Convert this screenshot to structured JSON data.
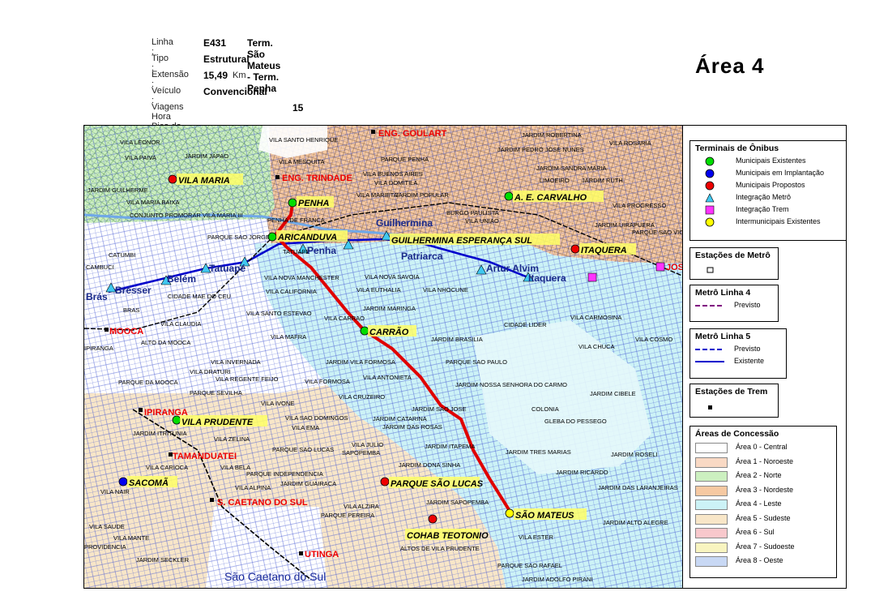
{
  "info": {
    "linha_label": "Linha :",
    "linha_value": "E431",
    "linha_name": "Term. São Mateus - Term. Penha",
    "tipo_label": "Tipo :",
    "tipo_value": "Estrutural",
    "extensao_label": "Extensão :",
    "extensao_value": "15,49",
    "extensao_unit": "Km",
    "veiculo_label": "Veículo :",
    "veiculo_value": "Convencional",
    "viagens_label": "Viagens Hora Pico da Manhã",
    "viagens_value": "15"
  },
  "area_title": "Área  4",
  "colors": {
    "route": "#e00000",
    "metro_line5": "#0000cc",
    "metro_line4": "#800080",
    "area_leste": "#cceeff",
    "area_nordeste": "#f4c49a",
    "area_norte": "#c8ecc0",
    "area_sudeste": "#f6e2c0",
    "area_central": "#ffffff",
    "street": "#2d3fc8"
  },
  "legend": {
    "terminais_title": "Terminais de Ônibus",
    "terminais": [
      {
        "label": "Municipais Existentes",
        "symbol": "green-circle"
      },
      {
        "label": "Municipais em Implantação",
        "symbol": "blue-circle"
      },
      {
        "label": "Municipais Propostos",
        "symbol": "red-circle"
      },
      {
        "label": "Integração Metrô",
        "symbol": "cyan-triangle"
      },
      {
        "label": "Integração Trem",
        "symbol": "magenta-square"
      },
      {
        "label": "Intermunicipais Existentes",
        "symbol": "yellow-circle"
      }
    ],
    "estacoes_metro_title": "Estações de Metrô",
    "metro4_title": "Metrô Linha 4",
    "metro4_items": [
      "Previsto"
    ],
    "metro5_title": "Metrô Linha 5",
    "metro5_items": [
      "Previsto",
      "Existente"
    ],
    "estacoes_trem_title": "Estações de Trem",
    "areas_title": "Áreas de Concessão",
    "areas": [
      {
        "label": "Área 0 - Central",
        "color": "#ffffff"
      },
      {
        "label": "Área 1 - Noroeste",
        "color": "#f9d9c4"
      },
      {
        "label": "Área 2 - Norte",
        "color": "#ccf0c0"
      },
      {
        "label": "Área 3 - Nordeste",
        "color": "#f6c9a2"
      },
      {
        "label": "Área 4 - Leste",
        "color": "#ccf2f6"
      },
      {
        "label": "Área 5 - Sudeste",
        "color": "#f8e6c8"
      },
      {
        "label": "Área 6 - Sul",
        "color": "#f8c8cc"
      },
      {
        "label": "Área 7 - Sudoeste",
        "color": "#f8f4c0"
      },
      {
        "label": "Área 8 - Oeste",
        "color": "#c8d8f4"
      }
    ]
  },
  "map_labels": {
    "terminals": {
      "penha": "PENHA",
      "aricanduva": "ARICANDUVA",
      "carrao": "CARRÃO",
      "sao_mateus": "SÃO MATEUS",
      "parque_sao_lucas": "PARQUE SÃO LUCAS",
      "cohab_teotonio": "COHAB TEOTONIO",
      "vila_prudente": "VILA PRUDENTE",
      "vila_maria": "VILA MARIA",
      "ae_carvalho": "A. E. CARVALHO",
      "itaquera": "ITAQUERA",
      "guilhermina_esperanca": "GUILHERMINA ESPERANÇA SUL",
      "sacoma": "SACOMÃ"
    },
    "metro": {
      "guilhermina": "Guilhermina",
      "penha": "Penha",
      "patriarca": "Patriarca",
      "artur_alvim": "Artur Alvim",
      "itaquera_st": "Itaquera",
      "tatuape": "Tatuapé",
      "belem": "Belém",
      "bresser": "Brésser",
      "bras": "Brás"
    },
    "trains": {
      "eng_goulart": "ENG. GOULART",
      "eng_trindade": "ENG. TRINDADE",
      "mooca": "MOOCA",
      "ipiranga": "IPIRANGA",
      "tamanduatei": "TAMANDUATEI",
      "s_caetano": "S. CAETANO DO SUL",
      "utinga": "UTINGA",
      "jose_bonifacio": "JOS"
    },
    "neighborhoods": [
      "VILA SANTO HENRIQUE",
      "PARQUE PENHA",
      "VILA MESQUITA",
      "VILA BUENOS AIRES",
      "VILA DOMITILA",
      "VILA MARIETA",
      "JARDIM POPULAR",
      "BURGO PAULISTA",
      "VILA UNIAO",
      "JARDIM ROBERTINA",
      "VILA ROSARIA",
      "JARDIM PEDRO JOSE NUNES",
      "JARDIM SANDRA MARIA",
      "LIMOEIRO",
      "JARDIM RUTH",
      "VILA PROGRESSO",
      "JARDIM UIRAPUERA",
      "PARQUE SAO VICENTE",
      "VILA LEONOR",
      "JARDIM JAPAO",
      "VILA PAIVA",
      "JARDIM GUILHERME",
      "VILA MARIA BAIXA",
      "CONJUNTO PROMORAR VILA MARIA III",
      "PENHA DE FRANCA",
      "PARQUE SAO JORGE",
      "TATUAPE",
      "CATUMBI",
      "VILA NOVA MANCHESTER",
      "VILA NOVA SAVOIA",
      "VILA CALIFORNIA",
      "VILA EUTHALIA",
      "VILA NHOCUNE",
      "CIDADE MAE DO CEU",
      "VILA SANTO ESTEVAO",
      "JARDIM MARINGA",
      "VILA CARRAO",
      "VILA MAFRA",
      "CIDADE LIDER",
      "VILA CARMOSINA",
      "JARDIM BRASILIA",
      "VILA CHUCA",
      "VILA COSMO",
      "VILA CLAUDIA",
      "ALTO DA MOOCA",
      "VILA INVERNADA",
      "JARDIM VILA FORMOSA",
      "PARQUE SAO PAULO",
      "VILA DRATURI",
      "VILA REGENTE FEIJO",
      "VILA FORMOSA",
      "VILA ANTONIETA",
      "JARDIM NOSSA SENHORA DO CARMO",
      "PARQUE DA MOOCA",
      "PARQUE SEVILHA",
      "JARDIM CIBELE",
      "VILA IVONE",
      "VILA CRUZEIRO",
      "JARDIM SAO JOSE",
      "COLONIA",
      "GLEBA DO PESSEGO",
      "VILA SAO DOMINGOS",
      "JARDIM CATARINA",
      "VILA EMA",
      "JARDIM DAS ROSAS",
      "VILA ZELINA",
      "JARDIM ITAPEMA",
      "JARDIM TRES MARIAS",
      "PARQUE SAO LUCAS",
      "SAPOPEMBA",
      "VILA JULIO",
      "JARDIM ROSELI",
      "VILA CARIOCA",
      "VILA BELA",
      "PARQUE INDEPENDENCIA",
      "JARDIM DONA SINHA",
      "JARDIM RICARDO",
      "JARDIM GUAIRACA",
      "VILA ALPINA",
      "JARDIM DAS LARANJEIRAS",
      "VILA NAIR",
      "VILA ALZIRA",
      "JARDIM SAPOPEMBA",
      "PARQUE PEREIRA",
      "JARDIM ALTO ALEGRE",
      "VILA ESTER",
      "VILA MANTE",
      "PROVIDENCIA",
      "JARDIM SECKLER",
      "ALTOS DE VILA PRUDENTE",
      "PARQUE SAO RAFAEL",
      "JARDIM ADOLFO PIRANI",
      "CAMBUCI",
      "BRAS",
      "JARDIM ITRITUNIA",
      "VILA SAUDE",
      "IPIRANGA"
    ],
    "city": "São Caetano do Sul"
  }
}
